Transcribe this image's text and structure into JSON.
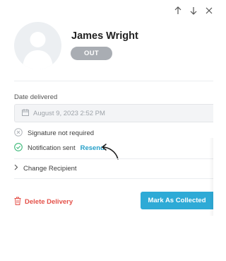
{
  "toolbar": {
    "icons": [
      "arrow-up-icon",
      "arrow-down-icon",
      "close-icon"
    ]
  },
  "recipient": {
    "name": "James Wright",
    "status": "OUT"
  },
  "delivery": {
    "date_label": "Date delivered",
    "date_value": "August 9, 2023 2:52 PM",
    "signature_text": "Signature not required",
    "notification_text": "Notification sent",
    "resend_label": "Resend",
    "change_recipient_label": "Change Recipient"
  },
  "actions": {
    "delete_label": "Delete Delivery",
    "collect_label": "Mark As Collected"
  },
  "colors": {
    "accent": "#2eaad6",
    "link": "#26a0c9",
    "danger": "#e45149",
    "success": "#3bb878",
    "badge": "#a9adb3"
  }
}
